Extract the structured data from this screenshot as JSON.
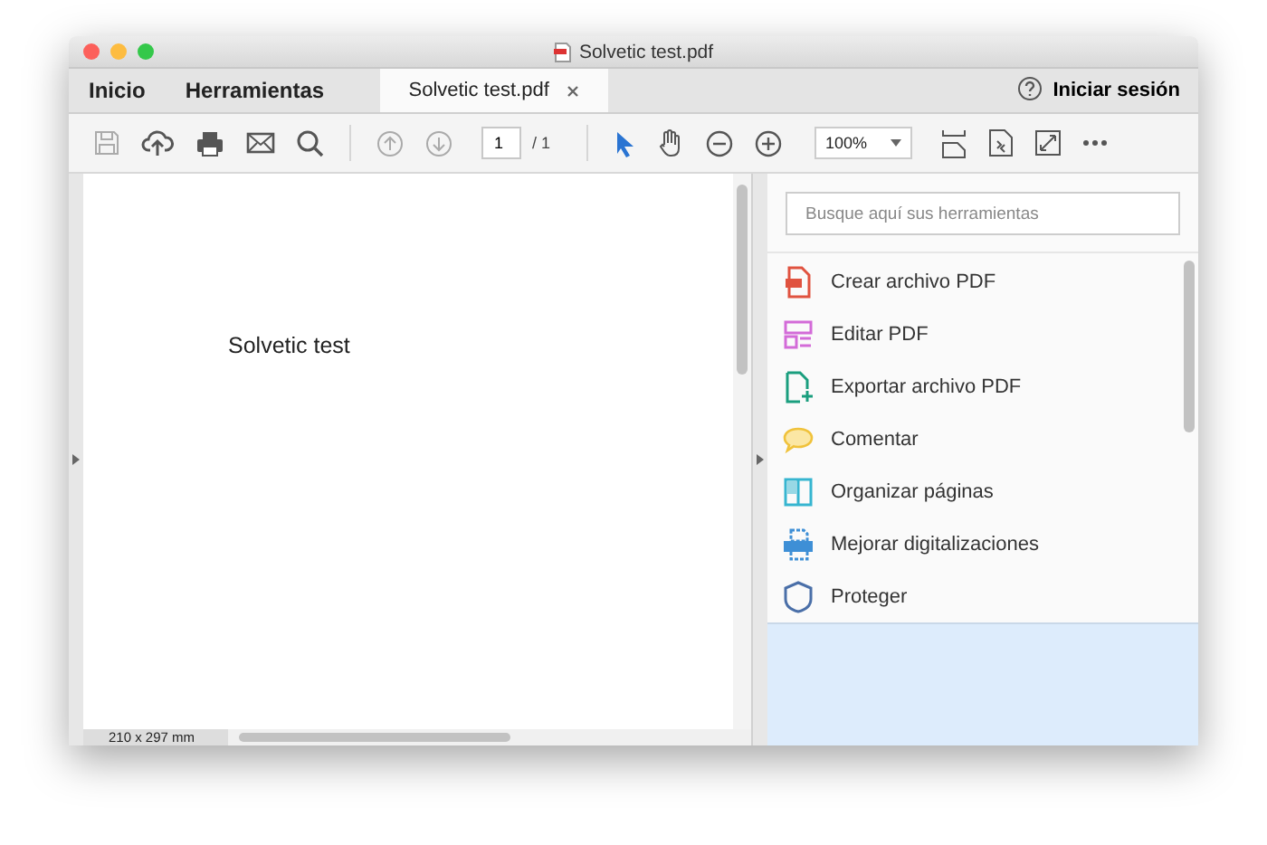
{
  "window": {
    "title": "Solvetic test.pdf"
  },
  "tabs": [
    {
      "label": "Inicio",
      "kind": "nav",
      "selected": false
    },
    {
      "label": "Herramientas",
      "kind": "nav",
      "selected": false
    },
    {
      "label": "Solvetic test.pdf",
      "kind": "document",
      "selected": true
    }
  ],
  "sign_in": "Iniciar sesión",
  "toolbar": {
    "page": "1",
    "page_total": "/ 1",
    "zoom": "100%"
  },
  "document": {
    "text": "Solvetic test",
    "page_size": "210 x 297 mm"
  },
  "tools_panel": {
    "search": {
      "placeholder": "Busque aquí sus herramientas"
    },
    "items": [
      {
        "label": "Crear archivo PDF",
        "kind": "create",
        "color": "#e0523f"
      },
      {
        "label": "Editar PDF",
        "kind": "edit",
        "color": "#d36bd8"
      },
      {
        "label": "Exportar archivo PDF",
        "kind": "export",
        "color": "#1a9e7e"
      },
      {
        "label": "Comentar",
        "kind": "comment",
        "color": "#f0c23b"
      },
      {
        "label": "Organizar páginas",
        "kind": "organize",
        "color": "#36b5d0"
      },
      {
        "label": "Mejorar digitalizaciones",
        "kind": "scan",
        "color": "#3e8fd6"
      },
      {
        "label": "Proteger",
        "kind": "protect",
        "color": "#4a6fa8"
      }
    ]
  }
}
